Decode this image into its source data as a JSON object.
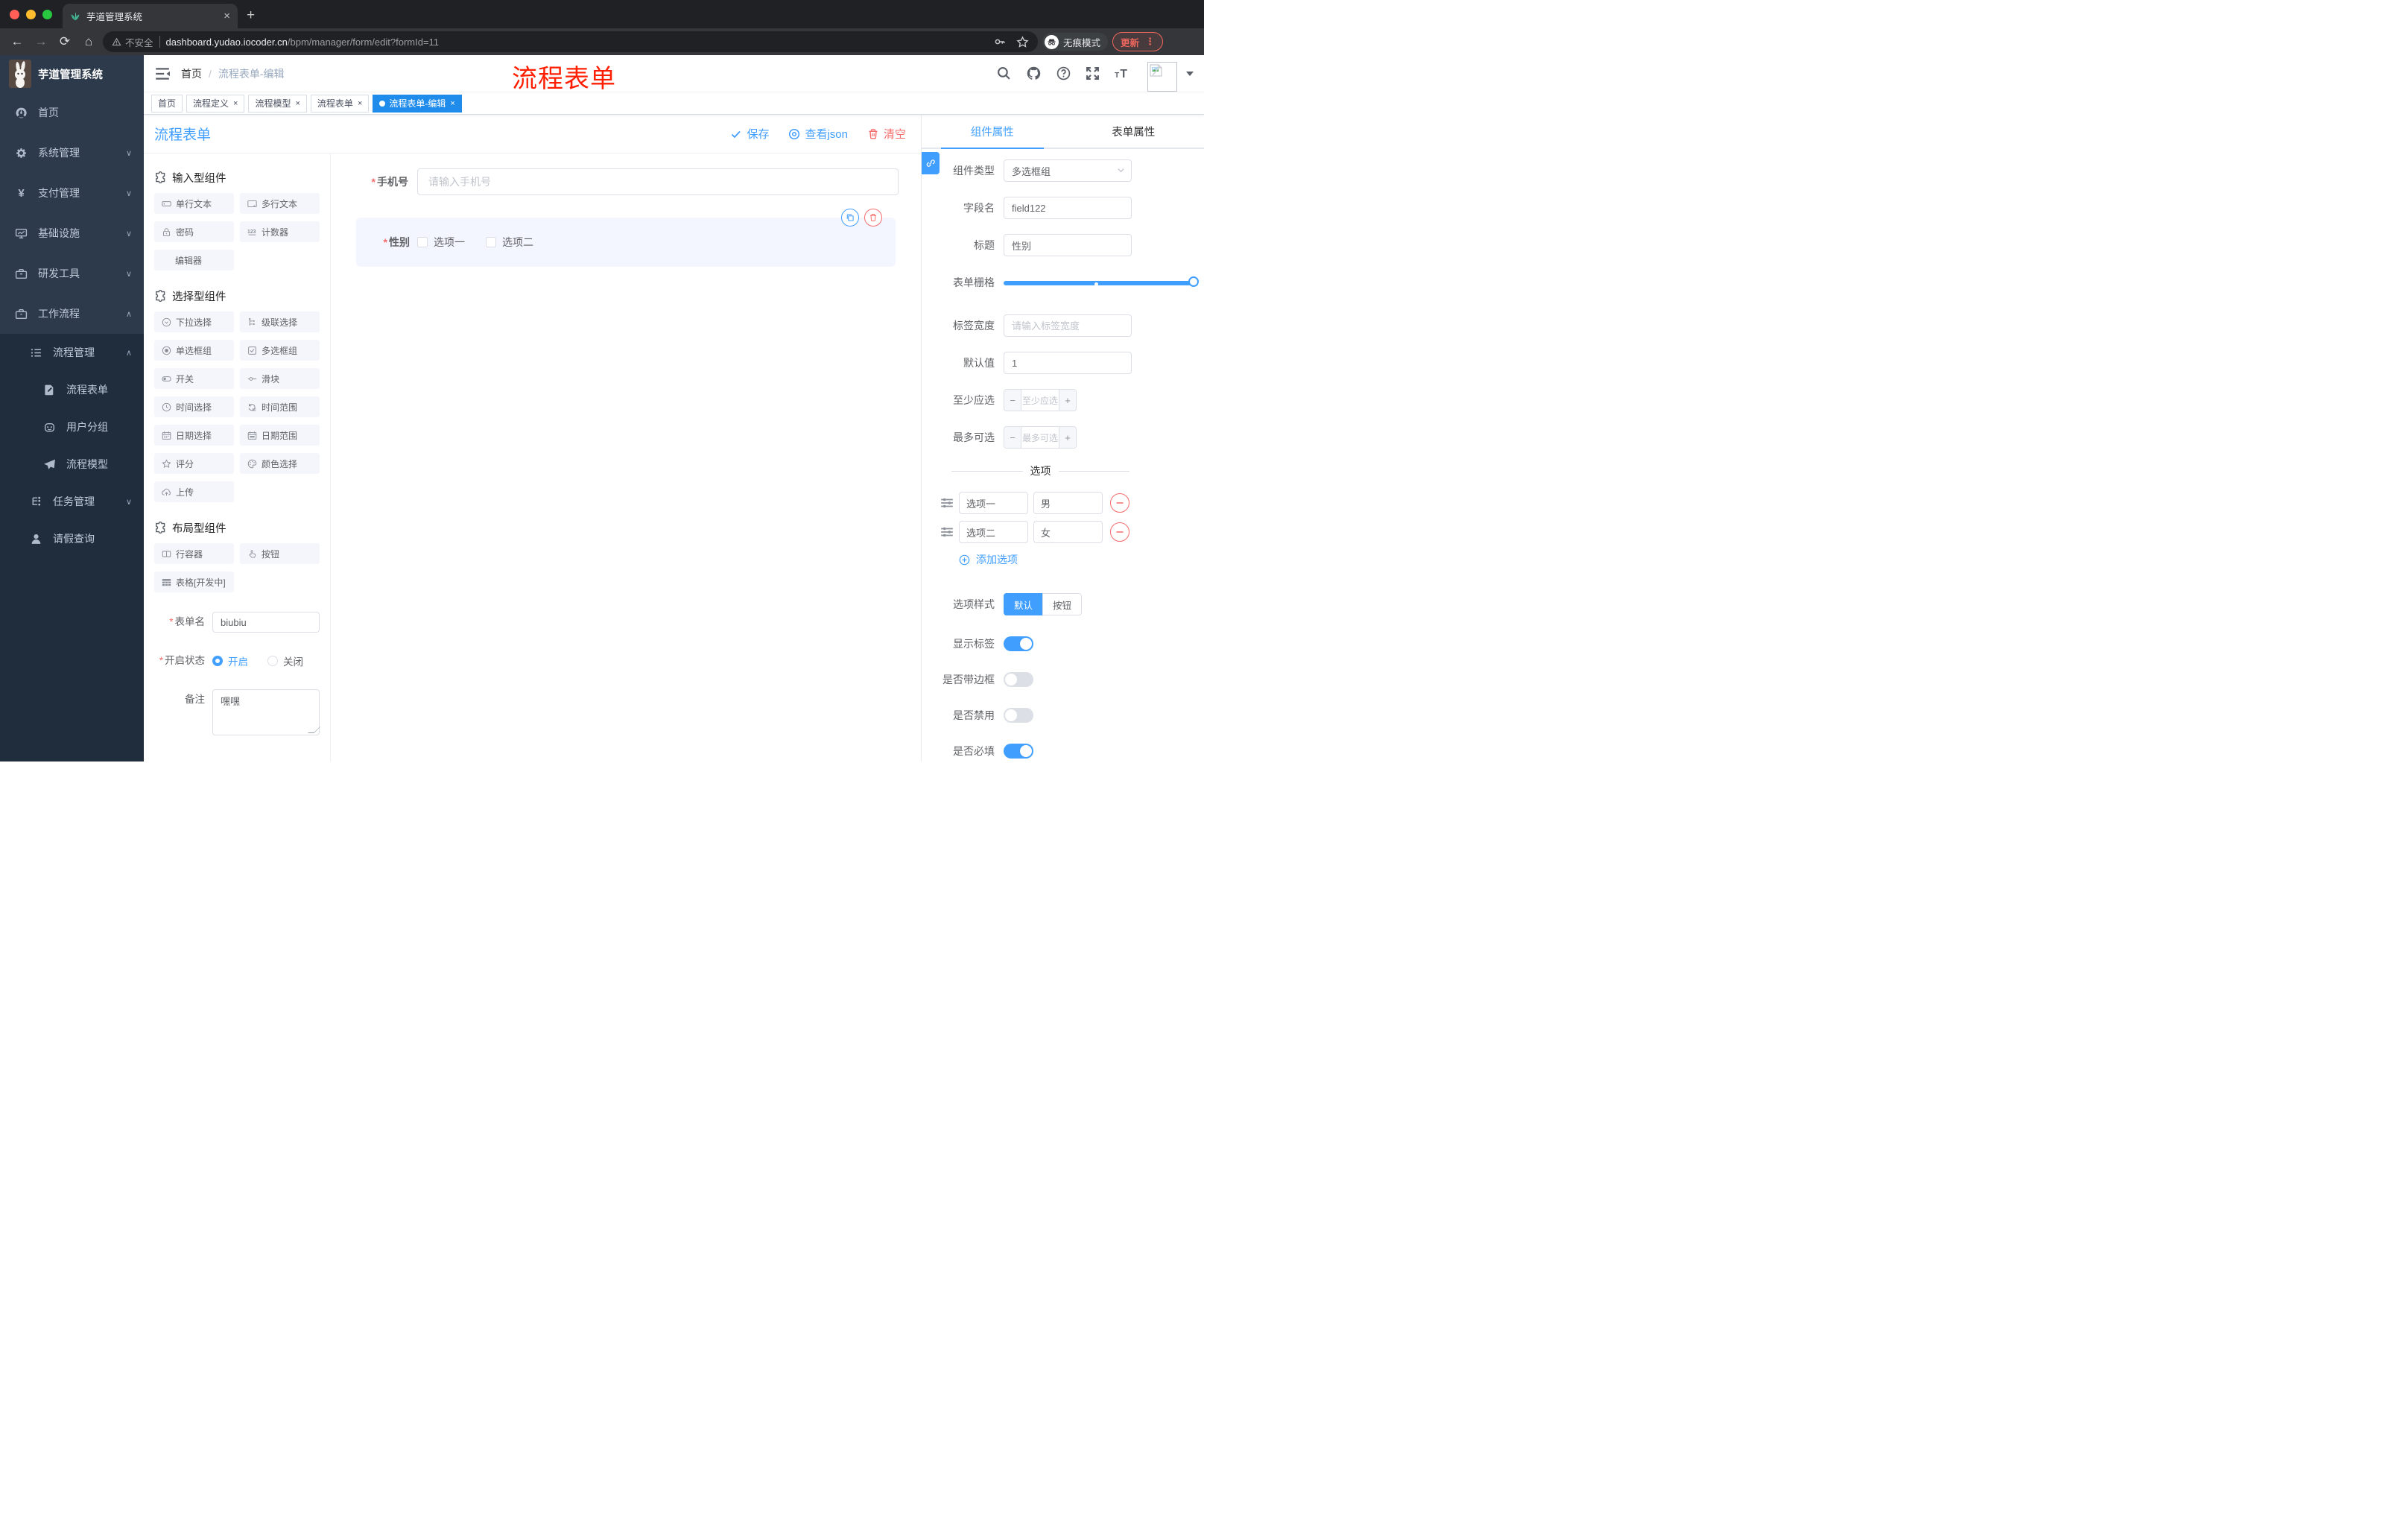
{
  "browser": {
    "tab_title": "芋道管理系统",
    "new_tab": "+",
    "close_tab": "×",
    "security_label": "不安全",
    "url_domain": "dashboard.yudao.iocoder.cn",
    "url_path": "/bpm/manager/form/edit?formId=11",
    "incognito_label": "无痕模式",
    "update_label": "更新"
  },
  "header": {
    "logo_title": "芋道管理系统",
    "breadcrumb_home": "首页",
    "breadcrumb_sep": "/",
    "breadcrumb_current": "流程表单-编辑",
    "annotation": "流程表单",
    "annotation_color": "#ff1f00"
  },
  "sidebar": {
    "items": [
      {
        "label": "首页",
        "icon": "dashboard-icon"
      },
      {
        "label": "系统管理",
        "icon": "gear-icon",
        "chevron": "down"
      },
      {
        "label": "支付管理",
        "icon": "yen-icon",
        "chevron": "down"
      },
      {
        "label": "基础设施",
        "icon": "monitor-icon",
        "chevron": "down"
      },
      {
        "label": "研发工具",
        "icon": "toolbox-icon",
        "chevron": "down"
      },
      {
        "label": "工作流程",
        "icon": "briefcase-icon",
        "chevron": "up"
      }
    ],
    "submenu": [
      {
        "label": "流程管理",
        "icon": "list-icon",
        "chevron": "up"
      },
      {
        "label": "流程表单",
        "icon": "form-edit-icon"
      },
      {
        "label": "用户分组",
        "icon": "robot-icon"
      },
      {
        "label": "流程模型",
        "icon": "plane-icon"
      },
      {
        "label": "任务管理",
        "icon": "tree-icon",
        "chevron": "down"
      },
      {
        "label": "请假查询",
        "icon": "user-icon"
      }
    ]
  },
  "tags_view": [
    {
      "label": "首页",
      "closable": false,
      "active": false
    },
    {
      "label": "流程定义",
      "closable": true,
      "active": false
    },
    {
      "label": "流程模型",
      "closable": true,
      "active": false
    },
    {
      "label": "流程表单",
      "closable": true,
      "active": false
    },
    {
      "label": "流程表单-编辑",
      "closable": true,
      "active": true
    }
  ],
  "designer": {
    "title": "流程表单",
    "save_label": "保存",
    "view_json_label": "查看json",
    "clear_label": "清空",
    "sections": [
      {
        "title": "输入型组件",
        "items": [
          {
            "label": "单行文本"
          },
          {
            "label": "多行文本"
          },
          {
            "label": "密码"
          },
          {
            "label": "计数器"
          },
          {
            "label": "编辑器"
          }
        ]
      },
      {
        "title": "选择型组件",
        "items": [
          {
            "label": "下拉选择"
          },
          {
            "label": "级联选择"
          },
          {
            "label": "单选框组"
          },
          {
            "label": "多选框组"
          },
          {
            "label": "开关"
          },
          {
            "label": "滑块"
          },
          {
            "label": "时间选择"
          },
          {
            "label": "时间范围"
          },
          {
            "label": "日期选择"
          },
          {
            "label": "日期范围"
          },
          {
            "label": "评分"
          },
          {
            "label": "颜色选择"
          },
          {
            "label": "上传"
          }
        ]
      },
      {
        "title": "布局型组件",
        "items": [
          {
            "label": "行容器"
          },
          {
            "label": "按钮"
          },
          {
            "label": "表格[开发中]"
          }
        ]
      }
    ],
    "form_config": {
      "name_label": "表单名",
      "name_value": "biubiu",
      "status_label": "开启状态",
      "status_on": "开启",
      "status_off": "关闭",
      "remark_label": "备注",
      "remark_value": "嘿嘿"
    },
    "canvas": {
      "phone_label": "手机号",
      "phone_placeholder": "请输入手机号",
      "gender_label": "性别",
      "gender_options": [
        "选项一",
        "选项二"
      ]
    }
  },
  "properties": {
    "tab_component": "组件属性",
    "tab_form": "表单属性",
    "component_type_label": "组件类型",
    "component_type_value": "多选框组",
    "field_name_label": "字段名",
    "field_name_value": "field122",
    "title_label": "标题",
    "title_value": "性别",
    "grid_label": "表单栅格",
    "label_width_label": "标签宽度",
    "label_width_placeholder": "请输入标签宽度",
    "default_label": "默认值",
    "default_value": "1",
    "min_label": "至少应选",
    "min_placeholder": "至少应选",
    "max_label": "最多可选",
    "max_placeholder": "最多可选",
    "options_title": "选项",
    "option_rows": [
      {
        "label": "选项一",
        "value": "男"
      },
      {
        "label": "选项二",
        "value": "女"
      }
    ],
    "add_option_label": "添加选项",
    "style_label": "选项样式",
    "style_default": "默认",
    "style_button": "按钮",
    "switches": [
      {
        "label": "显示标签",
        "on": true
      },
      {
        "label": "是否带边框",
        "on": false
      },
      {
        "label": "是否禁用",
        "on": false
      },
      {
        "label": "是否必填",
        "on": true
      }
    ],
    "accent_color": "#409eff",
    "danger_color": "#f56c6c"
  }
}
